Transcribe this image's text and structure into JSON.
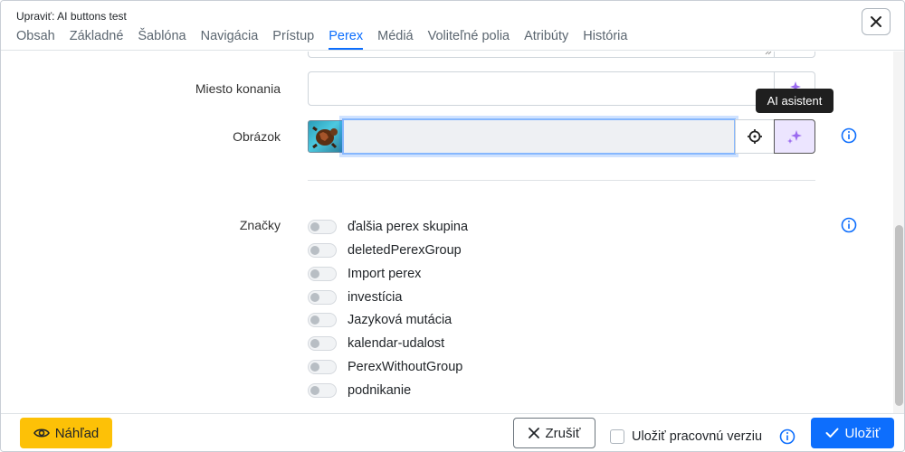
{
  "header": {
    "title": "Upraviť: AI buttons test",
    "tabs": [
      {
        "label": "Obsah"
      },
      {
        "label": "Základné"
      },
      {
        "label": "Šablóna"
      },
      {
        "label": "Navigácia"
      },
      {
        "label": "Prístup"
      },
      {
        "label": "Perex"
      },
      {
        "label": "Médiá"
      },
      {
        "label": "Voliteľné polia"
      },
      {
        "label": "Atribúty"
      },
      {
        "label": "História"
      }
    ],
    "active_tab": "Perex"
  },
  "form": {
    "location_label": "Miesto konania",
    "location_value": "",
    "image_label": "Obrázok",
    "image_value": "",
    "tags_label": "Značky",
    "tags": [
      {
        "label": "ďalšia perex skupina",
        "checked": false
      },
      {
        "label": "deletedPerexGroup",
        "checked": false
      },
      {
        "label": "Import perex",
        "checked": false
      },
      {
        "label": "investícia",
        "checked": false
      },
      {
        "label": "Jazyková mutácia",
        "checked": false
      },
      {
        "label": "kalendar-udalost",
        "checked": false
      },
      {
        "label": "PerexWithoutGroup",
        "checked": false
      },
      {
        "label": "podnikanie",
        "checked": false
      }
    ]
  },
  "tooltip": {
    "text": "AI asistent"
  },
  "footer": {
    "preview_label": "Náhľad",
    "cancel_label": "Zrušiť",
    "save_draft_label": "Uložiť pracovnú verziu",
    "save_draft_checked": false,
    "save_label": "Uložiť"
  },
  "colors": {
    "accent": "#0d6efd",
    "preview_button": "#fdc107",
    "ai_button_bg": "#ece5ff",
    "ai_icon": "#9b6bf0"
  }
}
